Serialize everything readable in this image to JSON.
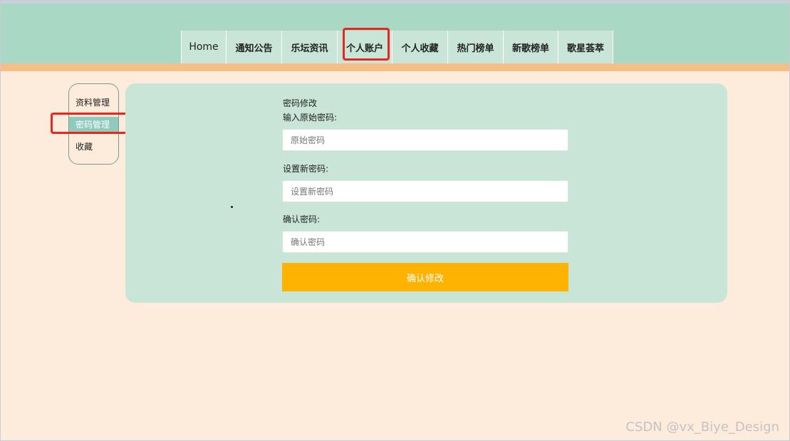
{
  "nav": {
    "items": [
      {
        "label": "Home"
      },
      {
        "label": "通知公告"
      },
      {
        "label": "乐坛资讯"
      },
      {
        "label": "个人账户"
      },
      {
        "label": "个人收藏"
      },
      {
        "label": "热门榜单"
      },
      {
        "label": "新歌榜单"
      },
      {
        "label": "歌星荟萃"
      }
    ],
    "active": "个人账户"
  },
  "sidebar": {
    "items": [
      {
        "label": "资料管理"
      },
      {
        "label": "密码管理"
      },
      {
        "label": "收藏"
      }
    ],
    "active": "密码管理"
  },
  "form": {
    "title": "密码修改",
    "old_label": "输入原始密码:",
    "old_placeholder": "原始密码",
    "new_label": "设置新密码:",
    "new_placeholder": "设置新密码",
    "confirm_label": "确认密码:",
    "confirm_placeholder": "确认密码",
    "submit_label": "确认修改"
  },
  "watermark": "CSDN @vx_Biye_Design",
  "colors": {
    "header": "#a9d8c4",
    "strip": "#f7bf88",
    "page": "#fdebdb",
    "panel": "#c8e5d8",
    "button": "#fdb300",
    "highlight": "#e8251f"
  }
}
